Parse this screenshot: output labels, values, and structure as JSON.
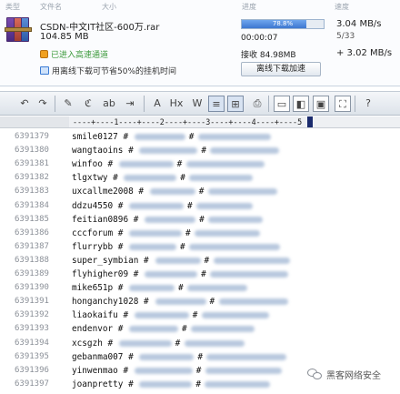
{
  "download": {
    "headers": {
      "type": "类型",
      "name": "文件名",
      "size": "大小",
      "progress": "进度",
      "speed": "速度"
    },
    "file_name": "CSDN-中文IT社区-600万.rar",
    "file_size": "104.85 MB",
    "speedup_status": "已进入高速通道",
    "offline_tip": "用离线下载可节省50%的挂机时间",
    "progress_percent": 78.8,
    "progress_label": "78.8%",
    "elapsed_time": "00:00:07",
    "received": "接收 84.98MB",
    "offline_button_label": "离线下载加速",
    "speed": "3.04 MB/s",
    "peers": "5/33",
    "bonus_speed": "+ 3.02 MB/s"
  },
  "toolbar": {
    "buttons": [
      {
        "name": "undo-button",
        "glyph": "↶"
      },
      {
        "name": "redo-button",
        "glyph": "↷"
      },
      {
        "name": "find-button",
        "glyph": "✎"
      },
      {
        "name": "replace-button",
        "glyph": "ℭ"
      },
      {
        "name": "spell-button",
        "glyph": "ab"
      },
      {
        "name": "indent-button",
        "glyph": "⇥"
      },
      {
        "name": "font-button",
        "glyph": "A"
      },
      {
        "name": "hex-button",
        "glyph": "Hx"
      },
      {
        "name": "wordwrap-button",
        "glyph": "W"
      },
      {
        "name": "line-numbers-button",
        "glyph": "≡"
      },
      {
        "name": "column-mode-button",
        "glyph": "⊞"
      },
      {
        "name": "print-button",
        "glyph": "⎙"
      },
      {
        "name": "view-button",
        "glyph": "▭"
      },
      {
        "name": "split-button",
        "glyph": "◧"
      },
      {
        "name": "tile-button",
        "glyph": "▣"
      },
      {
        "name": "fullscreen-button",
        "glyph": "⛶"
      },
      {
        "name": "help-button",
        "glyph": "?"
      }
    ]
  },
  "ruler": {
    "text": "----+----1----+----2----+----3----+----4----+----5"
  },
  "lines": [
    {
      "n": "6391379",
      "user": "smile0127 #"
    },
    {
      "n": "6391380",
      "user": "wangtaoins #"
    },
    {
      "n": "6391381",
      "user": "winfoo #"
    },
    {
      "n": "6391382",
      "user": "tlgxtwy #"
    },
    {
      "n": "6391383",
      "user": "uxcallme2008 #"
    },
    {
      "n": "6391384",
      "user": "ddzu4550 #"
    },
    {
      "n": "6391385",
      "user": "feitian0896 #"
    },
    {
      "n": "6391386",
      "user": "cccforum #"
    },
    {
      "n": "6391387",
      "user": "flurrybb #"
    },
    {
      "n": "6391388",
      "user": "super_symbian #"
    },
    {
      "n": "6391389",
      "user": "flyhigher09 #"
    },
    {
      "n": "6391390",
      "user": "mike651p #"
    },
    {
      "n": "6391391",
      "user": "honganchy1028 #"
    },
    {
      "n": "6391392",
      "user": "liaokaifu #"
    },
    {
      "n": "6391393",
      "user": "endenvor #"
    },
    {
      "n": "6391394",
      "user": "xcsgzh #"
    },
    {
      "n": "6391395",
      "user": "gebanma007 #"
    },
    {
      "n": "6391396",
      "user": "yinwenmao #"
    },
    {
      "n": "6391397",
      "user": "joanpretty #"
    }
  ],
  "watermark": "黑客网络安全",
  "colors": {
    "accent": "#3d77d0",
    "green": "#3c9a3c"
  }
}
